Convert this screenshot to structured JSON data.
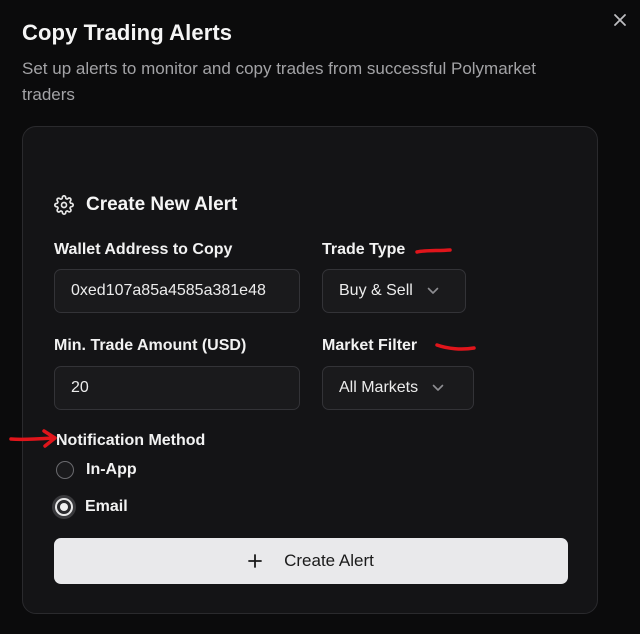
{
  "dialog": {
    "title": "Copy Trading Alerts",
    "subtitle": "Set up alerts to monitor and copy trades from successful Polymarket traders"
  },
  "card": {
    "title": "Create New Alert",
    "wallet": {
      "label": "Wallet Address to Copy",
      "value": "0xed107a85a4585a381e48"
    },
    "trade_type": {
      "label": "Trade Type",
      "selected": "Buy & Sell"
    },
    "min_amount": {
      "label": "Min. Trade Amount (USD)",
      "value": "20"
    },
    "market_filter": {
      "label": "Market Filter",
      "selected": "All Markets"
    },
    "notification": {
      "label": "Notification Method",
      "options": [
        "In-App",
        "Email"
      ],
      "selected": "Email"
    },
    "submit_label": "Create Alert"
  },
  "colors": {
    "background": "#0b0b0c",
    "card": "#141416",
    "button": "#e9e9eb",
    "annotation": "#e0151b"
  },
  "icons": [
    "close-icon",
    "gear-icon",
    "chevron-down-icon",
    "plus-icon"
  ]
}
